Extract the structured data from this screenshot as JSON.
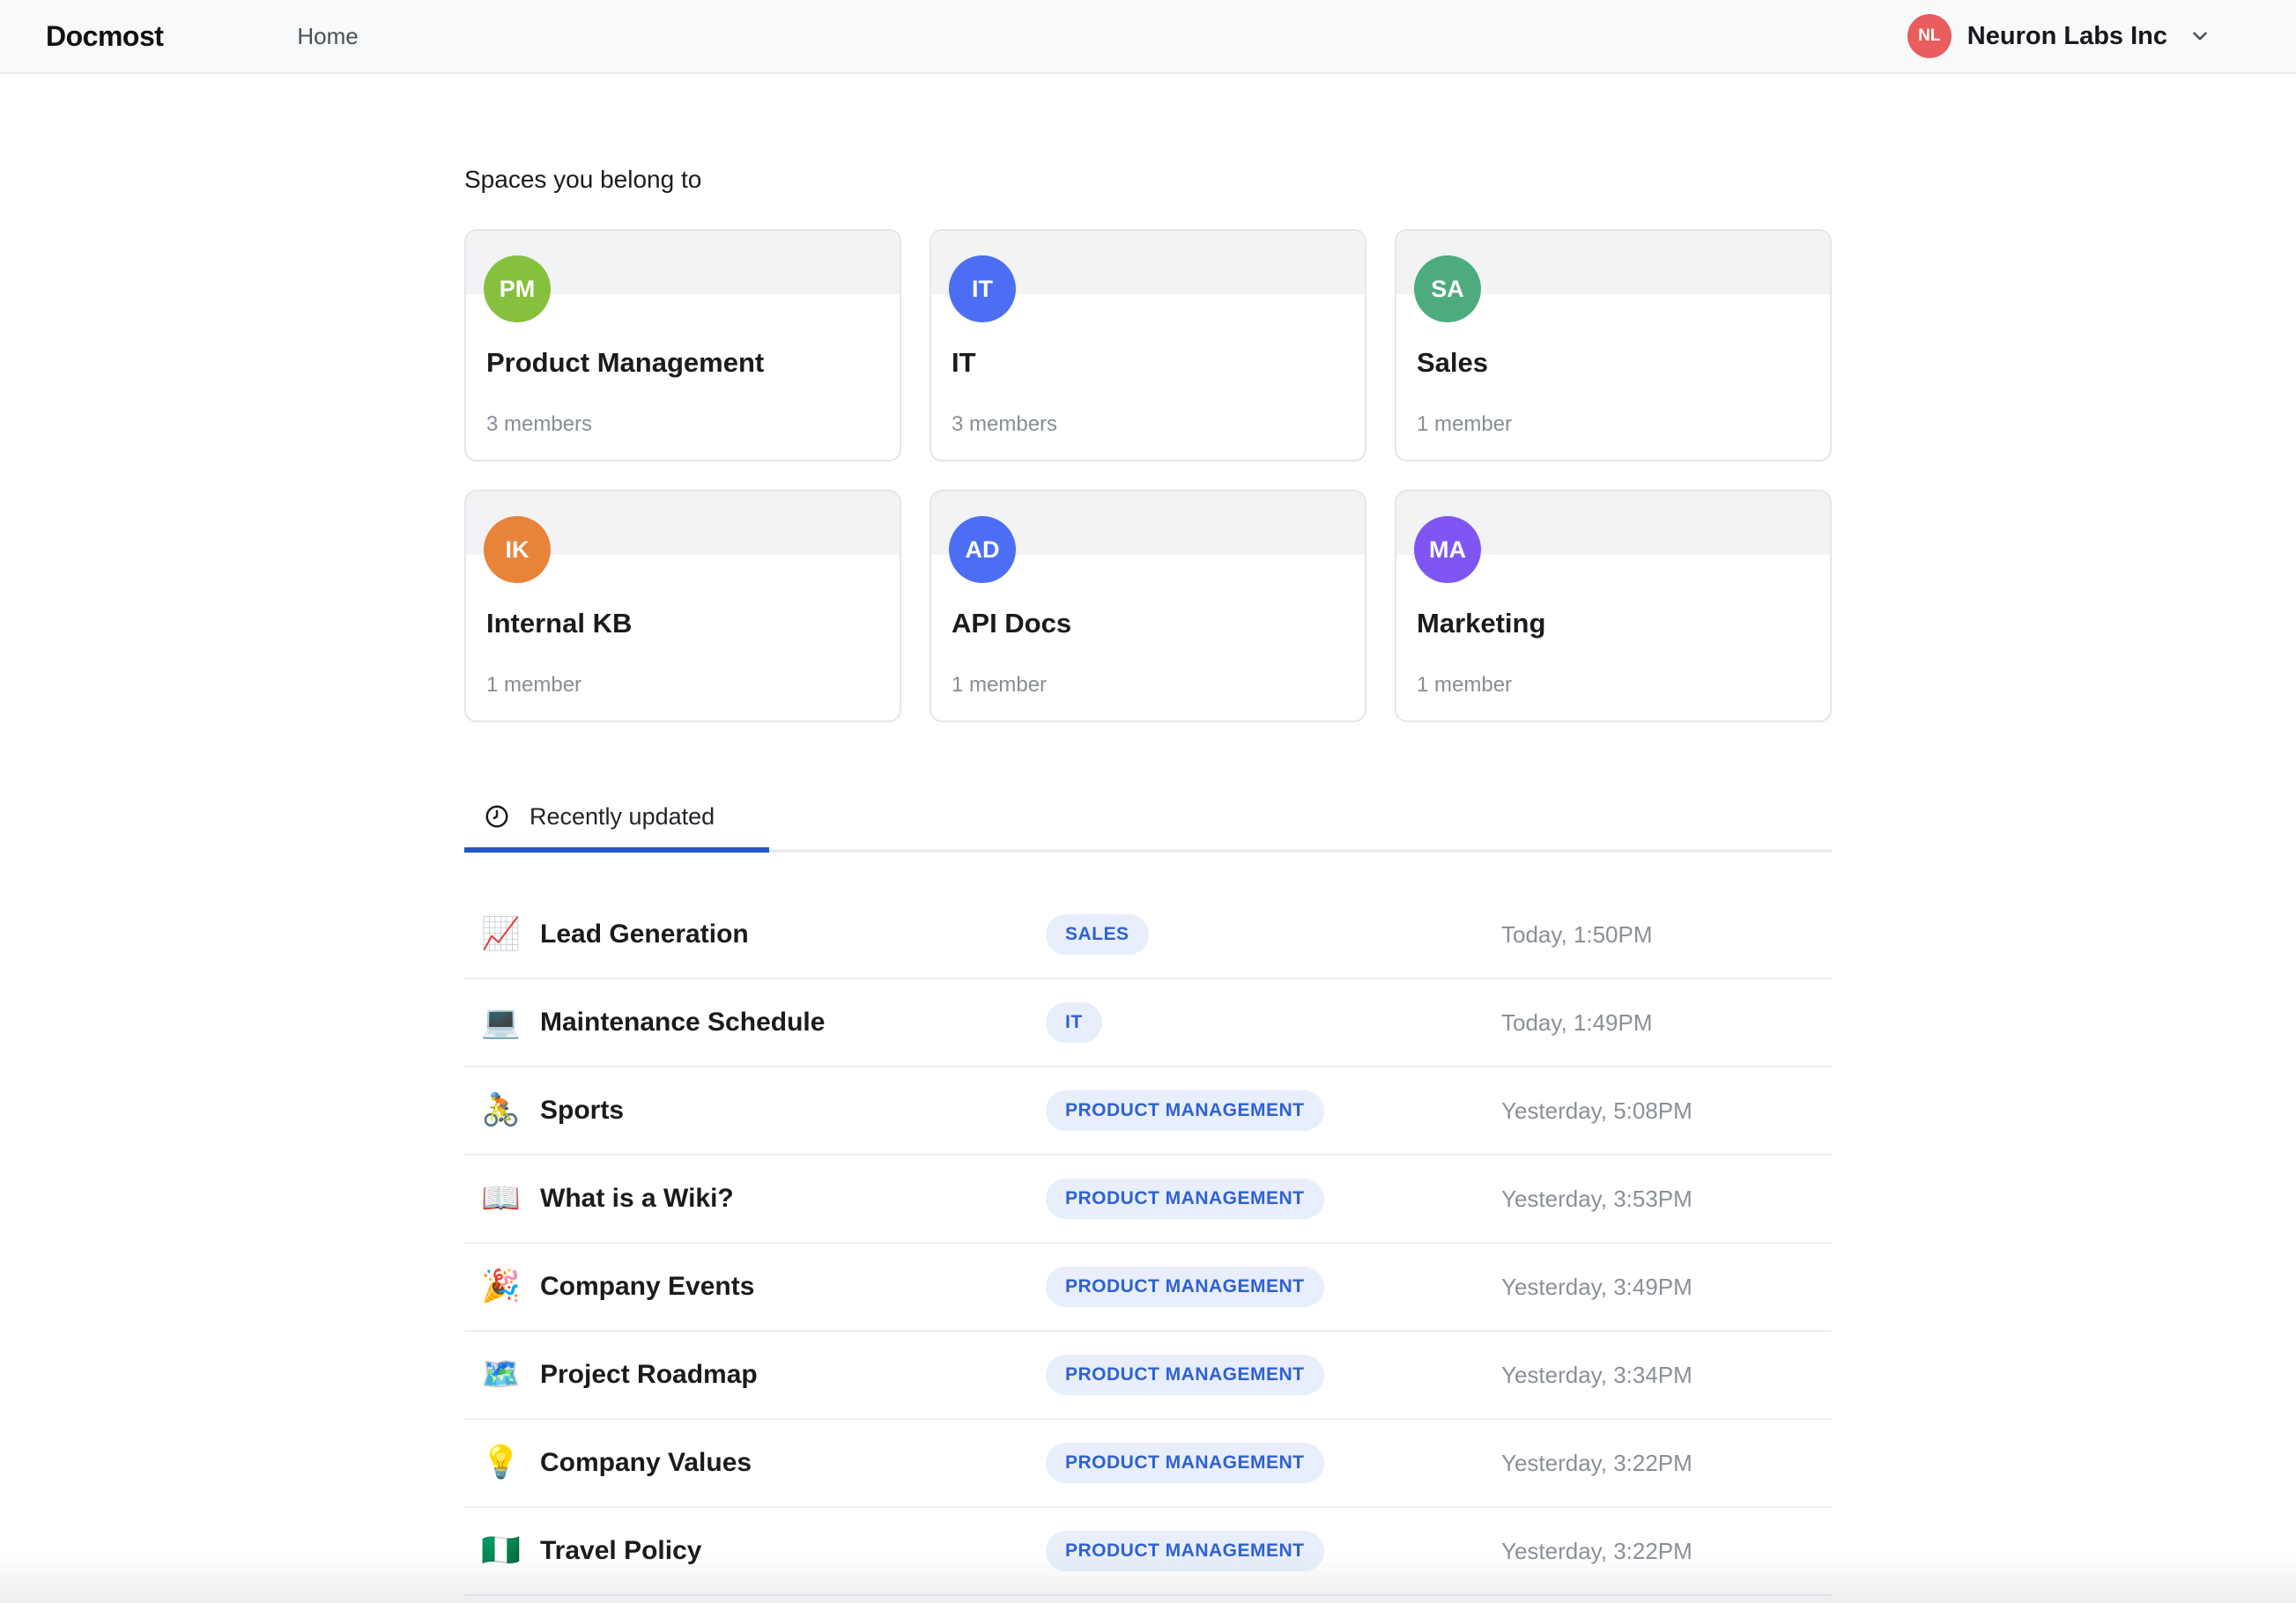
{
  "topbar": {
    "logo": "Docmost",
    "nav": {
      "home": "Home"
    },
    "workspace": {
      "initials": "NL",
      "name": "Neuron Labs Inc",
      "avatar_color": "#e85d5d"
    }
  },
  "spaces": {
    "heading": "Spaces you belong to",
    "cards": [
      {
        "initials": "PM",
        "name": "Product Management",
        "members": "3 members",
        "color": "#85c13e"
      },
      {
        "initials": "IT",
        "name": "IT",
        "members": "3 members",
        "color": "#4c6ef5"
      },
      {
        "initials": "SA",
        "name": "Sales",
        "members": "1 member",
        "color": "#4dab7e"
      },
      {
        "initials": "IK",
        "name": "Internal KB",
        "members": "1 member",
        "color": "#e8833a"
      },
      {
        "initials": "AD",
        "name": "API Docs",
        "members": "1 member",
        "color": "#4c6ef5"
      },
      {
        "initials": "MA",
        "name": "Marketing",
        "members": "1 member",
        "color": "#7f56f3"
      }
    ]
  },
  "recent": {
    "tab_label": "Recently updated",
    "rows": [
      {
        "icon": "📈",
        "title": "Lead Generation",
        "badge": "SALES",
        "time": "Today, 1:50PM"
      },
      {
        "icon": "💻",
        "title": "Maintenance Schedule",
        "badge": "IT",
        "time": "Today, 1:49PM"
      },
      {
        "icon": "🚴",
        "title": "Sports",
        "badge": "PRODUCT MANAGEMENT",
        "time": "Yesterday, 5:08PM"
      },
      {
        "icon": "📖",
        "title": "What is a Wiki?",
        "badge": "PRODUCT MANAGEMENT",
        "time": "Yesterday, 3:53PM"
      },
      {
        "icon": "🎉",
        "title": "Company Events",
        "badge": "PRODUCT MANAGEMENT",
        "time": "Yesterday, 3:49PM"
      },
      {
        "icon": "🗺️",
        "title": "Project Roadmap",
        "badge": "PRODUCT MANAGEMENT",
        "time": "Yesterday, 3:34PM"
      },
      {
        "icon": "💡",
        "title": "Company Values",
        "badge": "PRODUCT MANAGEMENT",
        "time": "Yesterday, 3:22PM"
      },
      {
        "icon": "🇳🇬",
        "title": "Travel Policy",
        "badge": "PRODUCT MANAGEMENT",
        "time": "Yesterday, 3:22PM"
      }
    ]
  },
  "colors": {
    "accent_tab_indicator": "#2457c5",
    "badge_background": "#e8eefb",
    "badge_text": "#2e61d3",
    "topbar_background": "#f8f9fa",
    "card_banner": "#f1f3f5"
  }
}
